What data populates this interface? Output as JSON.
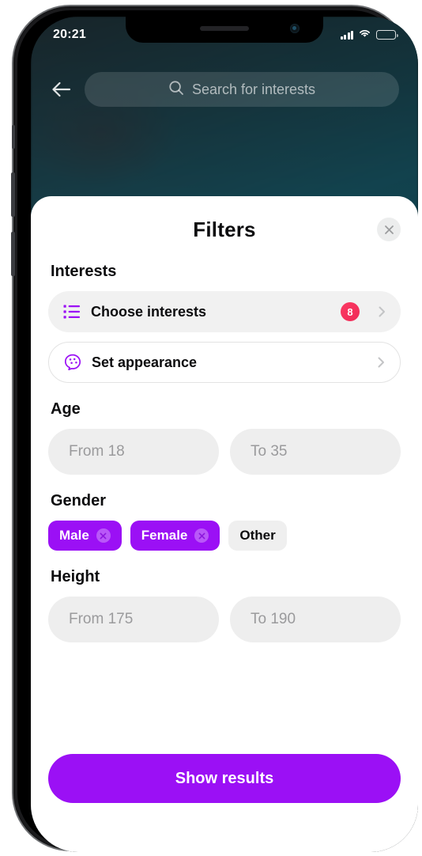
{
  "status_bar": {
    "time": "20:21",
    "signal_icon": "cellular-signal-icon",
    "wifi_icon": "wifi-icon",
    "battery_icon": "battery-icon",
    "battery_color": "#f2c14e"
  },
  "header": {
    "back_icon": "back-arrow-icon",
    "search_icon": "search-icon",
    "search_placeholder": "Search for interests"
  },
  "sheet": {
    "title": "Filters",
    "close_icon": "close-icon",
    "sections": [
      {
        "title": "Interests",
        "rows": [
          {
            "label": "Choose interests",
            "icon": "list-icon",
            "badge": "8",
            "chevron": "chevron-right-icon",
            "style": "filled"
          },
          {
            "label": "Set appearance",
            "icon": "palette-icon",
            "badge": "",
            "chevron": "chevron-right-icon",
            "style": "outline"
          }
        ]
      },
      {
        "title": "Age",
        "from_placeholder": "From 18",
        "to_placeholder": "To 35"
      },
      {
        "title": "Gender",
        "chips": [
          {
            "label": "Male",
            "selected": true
          },
          {
            "label": "Female",
            "selected": true
          },
          {
            "label": "Other",
            "selected": false
          }
        ]
      },
      {
        "title": "Height",
        "from_placeholder": "From 175",
        "to_placeholder": "To 190"
      }
    ],
    "cta_label": "Show results"
  },
  "colors": {
    "accent_purple": "#9b10f5",
    "badge_red": "#f02a57",
    "field_gray": "#eeeeee",
    "chip_gray": "#efefef",
    "text_dark": "#0c0c0e",
    "placeholder_gray": "#9a9a9c"
  }
}
